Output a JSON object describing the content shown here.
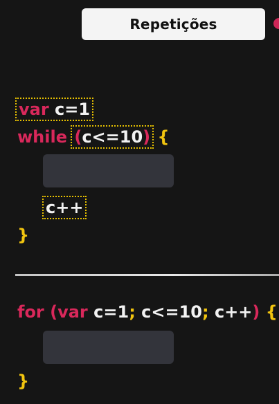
{
  "title": "Repetições",
  "colors": {
    "keyword": "#d9285b",
    "brace": "#f1c40f",
    "text": "#f2f2f2",
    "highlight_outline": "#e6c000",
    "placeholder": "#33343b",
    "background": "#151515"
  },
  "while_block": {
    "decl_keyword": "var",
    "decl_rest": "c=1",
    "loop_keyword": "while",
    "open_paren": "(",
    "condition": "c<=10",
    "close_paren": ")",
    "open_brace": "{",
    "increment": "c++",
    "close_brace": "}"
  },
  "for_block": {
    "keyword_for": "for",
    "open_paren": "(",
    "keyword_var": "var",
    "init": "c=1",
    "sep1": ";",
    "condition": "c<=10",
    "sep2": ";",
    "increment": "c++",
    "close_paren": ")",
    "open_brace": "{",
    "close_brace": "}"
  }
}
